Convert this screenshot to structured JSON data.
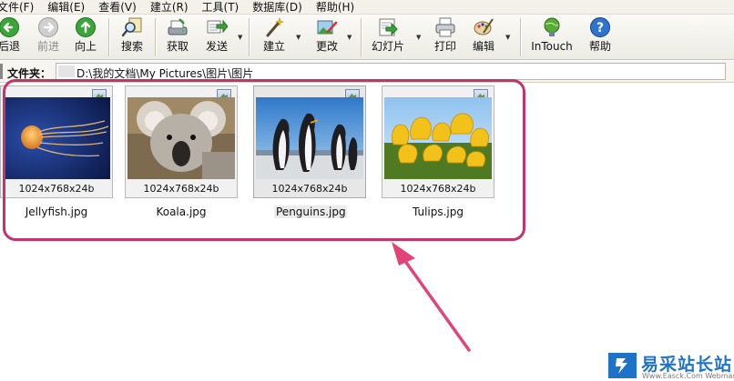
{
  "menu": [
    "文件(F)",
    "编辑(E)",
    "查看(V)",
    "建立(R)",
    "工具(T)",
    "数据库(D)",
    "帮助(H)"
  ],
  "toolbar": {
    "back": "后退",
    "forward": "前进",
    "up": "向上",
    "search": "搜索",
    "acquire": "获取",
    "send": "发送",
    "create": "建立",
    "change": "更改",
    "slideshow": "幻灯片",
    "print": "打印",
    "edit": "编辑",
    "intouch": "InTouch",
    "help": "帮助"
  },
  "folder": {
    "label": "文件夹：",
    "path": "D:\\我的文档\\My Pictures\\图片\\图片"
  },
  "thumbnails": [
    {
      "name": "Jellyfish.jpg",
      "resolution": "1024x768x24b"
    },
    {
      "name": "Koala.jpg",
      "resolution": "1024x768x24b"
    },
    {
      "name": "Penguins.jpg",
      "resolution": "1024x768x24b"
    },
    {
      "name": "Tulips.jpg",
      "resolution": "1024x768x24b"
    }
  ],
  "watermark": {
    "title": "易采站长站",
    "subtitle": "Www.Easck.Com Webmaster"
  },
  "colors": {
    "highlight": "#c6336a",
    "watermark": "#1e73c8"
  }
}
